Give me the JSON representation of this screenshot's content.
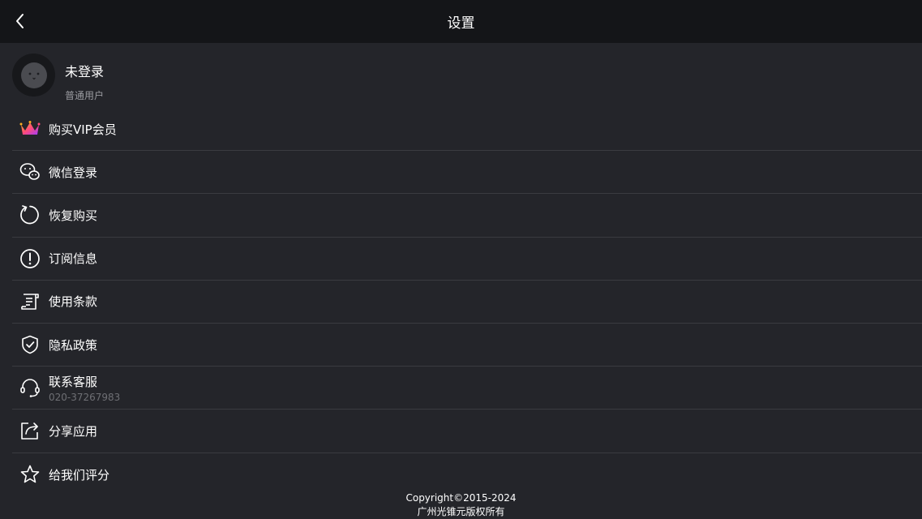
{
  "header": {
    "title": "设置"
  },
  "profile": {
    "name": "未登录",
    "role": "普通用户"
  },
  "menu": {
    "items": [
      {
        "label": "购买VIP会员",
        "icon": "crown-icon"
      },
      {
        "label": "微信登录",
        "icon": "wechat-icon"
      },
      {
        "label": "恢复购买",
        "icon": "restore-icon"
      },
      {
        "label": "订阅信息",
        "icon": "info-icon"
      },
      {
        "label": "使用条款",
        "icon": "terms-icon"
      },
      {
        "label": "隐私政策",
        "icon": "shield-icon"
      },
      {
        "label": "联系客服",
        "sub": "020-37267983",
        "icon": "headset-icon"
      },
      {
        "label": "分享应用",
        "icon": "share-icon"
      },
      {
        "label": "给我们评分",
        "icon": "star-icon"
      }
    ]
  },
  "footer": {
    "copyright": "Copyright©2015-2024",
    "owner": "广州光锥元版权所有"
  },
  "colors": {
    "background": "#24252a",
    "header": "#141518",
    "divider": "#3a3b40",
    "muted": "#9a9ba0"
  }
}
